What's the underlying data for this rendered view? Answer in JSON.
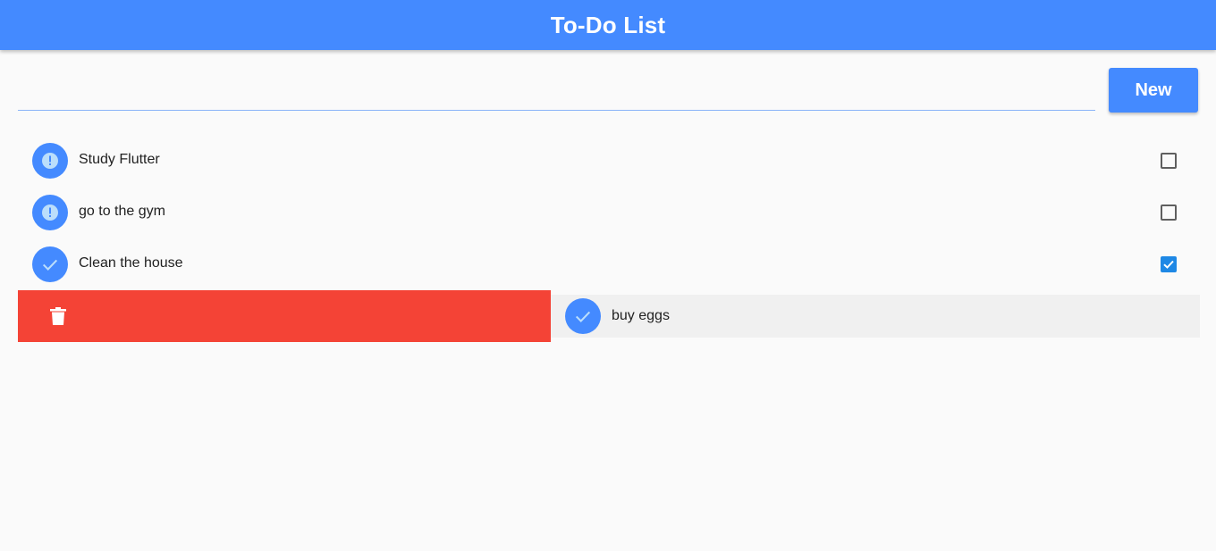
{
  "appbar": {
    "title": "To-Do List"
  },
  "input": {
    "value": "",
    "placeholder": ""
  },
  "new_button": {
    "label": "New"
  },
  "todos": [
    {
      "title": "Study Flutter",
      "done": false,
      "icon": "error-icon"
    },
    {
      "title": "go to the gym",
      "done": false,
      "icon": "error-icon"
    },
    {
      "title": "Clean the house",
      "done": true,
      "icon": "check-icon"
    }
  ],
  "dismissing_item": {
    "title": "buy eggs",
    "icon": "check-icon",
    "action_icon": "delete-icon"
  },
  "colors": {
    "primary": "#448aff",
    "delete_background": "#f44336",
    "checkbox_checked": "#1e88e5"
  }
}
